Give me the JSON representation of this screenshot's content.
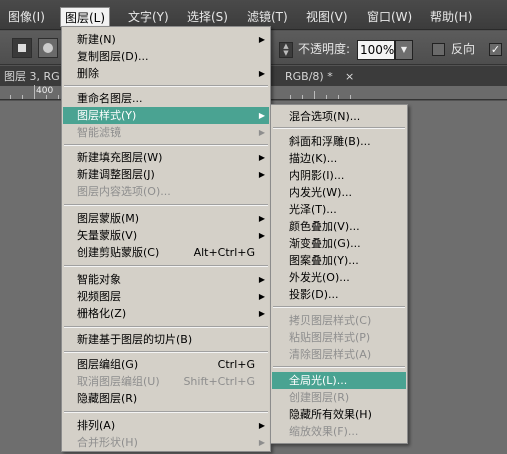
{
  "menubar": {
    "items": [
      {
        "label": "图像(I)"
      },
      {
        "label": "图层(L)"
      },
      {
        "label": "文字(Y)"
      },
      {
        "label": "选择(S)"
      },
      {
        "label": "滤镜(T)"
      },
      {
        "label": "视图(V)"
      },
      {
        "label": "窗口(W)"
      },
      {
        "label": "帮助(H)"
      }
    ]
  },
  "options": {
    "opacity_label": "不透明度:",
    "opacity_value": "100%",
    "reverse_label": "反向",
    "check_mark": "✓"
  },
  "tabs": {
    "left_text": "图层 3, RG",
    "right_text": "RGB/8) *",
    "close": "×"
  },
  "ruler": {
    "numbers": [
      "400"
    ]
  },
  "layer_menu": {
    "items": [
      {
        "label": "新建(N)",
        "arrow": "▶"
      },
      {
        "label": "复制图层(D)..."
      },
      {
        "label": "删除",
        "arrow": "▶"
      },
      {
        "label": "重命名图层..."
      },
      {
        "label": "图层样式(Y)",
        "arrow": "▶"
      },
      {
        "label": "智能滤镜",
        "arrow": "▶"
      },
      {
        "label": "新建填充图层(W)",
        "arrow": "▶"
      },
      {
        "label": "新建调整图层(J)",
        "arrow": "▶"
      },
      {
        "label": "图层内容选项(O)..."
      },
      {
        "label": "图层蒙版(M)",
        "arrow": "▶"
      },
      {
        "label": "矢量蒙版(V)",
        "arrow": "▶"
      },
      {
        "label": "创建剪贴蒙版(C)",
        "shortcut": "Alt+Ctrl+G"
      },
      {
        "label": "智能对象",
        "arrow": "▶"
      },
      {
        "label": "视频图层",
        "arrow": "▶"
      },
      {
        "label": "栅格化(Z)",
        "arrow": "▶"
      },
      {
        "label": "新建基于图层的切片(B)"
      },
      {
        "label": "图层编组(G)",
        "shortcut": "Ctrl+G"
      },
      {
        "label": "取消图层编组(U)",
        "shortcut": "Shift+Ctrl+G"
      },
      {
        "label": "隐藏图层(R)"
      },
      {
        "label": "排列(A)",
        "arrow": "▶"
      },
      {
        "label": "合并形状(H)",
        "arrow": "▶"
      }
    ]
  },
  "style_menu": {
    "items": [
      {
        "label": "混合选项(N)..."
      },
      {
        "label": "斜面和浮雕(B)..."
      },
      {
        "label": "描边(K)..."
      },
      {
        "label": "内阴影(I)..."
      },
      {
        "label": "内发光(W)..."
      },
      {
        "label": "光泽(T)..."
      },
      {
        "label": "颜色叠加(V)..."
      },
      {
        "label": "渐变叠加(G)..."
      },
      {
        "label": "图案叠加(Y)..."
      },
      {
        "label": "外发光(O)..."
      },
      {
        "label": "投影(D)..."
      },
      {
        "label": "拷贝图层样式(C)"
      },
      {
        "label": "粘贴图层样式(P)"
      },
      {
        "label": "清除图层样式(A)"
      },
      {
        "label": "全局光(L)..."
      },
      {
        "label": "创建图层(R)"
      },
      {
        "label": "隐藏所有效果(H)"
      },
      {
        "label": "缩放效果(F)..."
      }
    ]
  },
  "colors": {
    "highlight": "#4aa392",
    "menu_bg": "#d4d0c8",
    "disabled": "#8e8e8e"
  }
}
